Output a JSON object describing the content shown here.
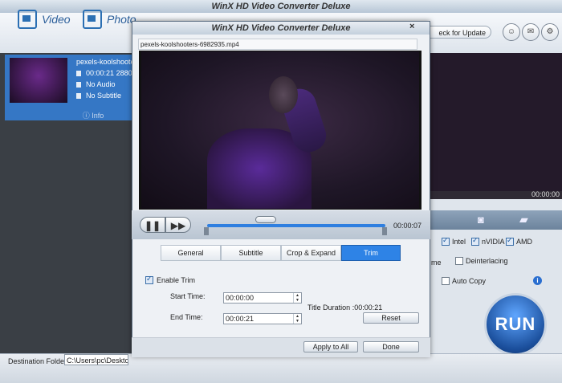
{
  "app_title": "WinX HD Video Converter Deluxe",
  "toolbar": {
    "video_label": "Video",
    "photo_label": "Photo",
    "check_update_label": "eck for Update"
  },
  "file_item": {
    "name": "pexels-koolshooters",
    "duration": "00:00:21",
    "resolution": "2880",
    "audio": "No Audio",
    "subtitle": "No Subtitle",
    "info_label": "Info"
  },
  "right_panel": {
    "time": "00:00:00",
    "hw": {
      "intel": "Intel",
      "nvidia": "nVIDIA",
      "amd": "AMD"
    },
    "partial_label": "me",
    "deinterlacing": "Deinterlacing",
    "auto_copy": "Auto Copy",
    "run_label": "RUN"
  },
  "bottom": {
    "dest_label": "Destination Folder:",
    "dest_value": "C:\\Users\\pc\\Desktop\\"
  },
  "dialog": {
    "title": "WinX HD Video Converter Deluxe",
    "close_glyph": "×",
    "filename": "pexels-koolshooters-6982935.mp4",
    "current_time": "00:00:07",
    "tabs": [
      "General",
      "Subtitle",
      "Crop & Expand",
      "Trim"
    ],
    "active_tab": "Trim",
    "trim": {
      "enable_label": "Enable Trim",
      "enabled": true,
      "start_label": "Start Time:",
      "start_value": "00:00:00",
      "end_label": "End Time:",
      "end_value": "00:00:21",
      "title_duration": "Title Duration :00:00:21",
      "reset_label": "Reset"
    },
    "apply_all_label": "Apply to All",
    "done_label": "Done"
  }
}
